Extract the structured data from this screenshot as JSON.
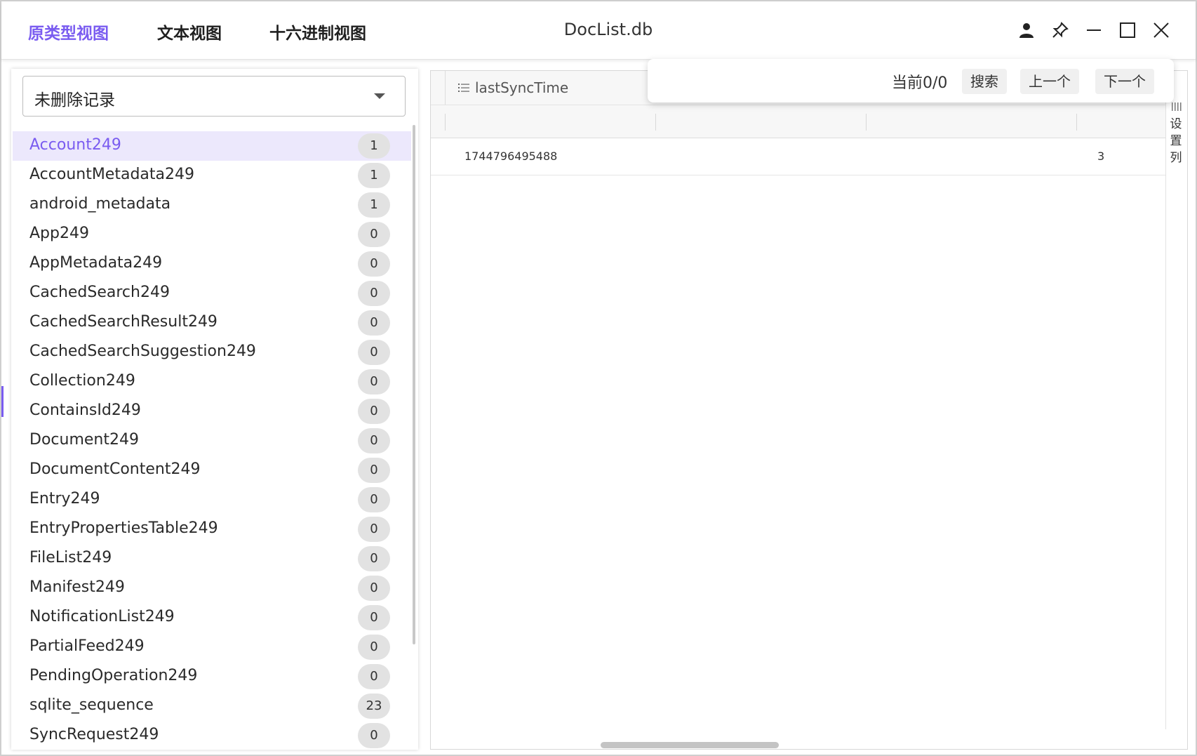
{
  "titlebar": {
    "tabs": [
      {
        "label": "原类型视图",
        "active": true
      },
      {
        "label": "文本视图",
        "active": false
      },
      {
        "label": "十六进制视图",
        "active": false
      }
    ],
    "title": "DocList.db",
    "icons": [
      "user-icon",
      "pin-icon",
      "minimize-icon",
      "maximize-icon",
      "close-icon"
    ]
  },
  "sidebar": {
    "filter": {
      "selected": "未删除记录"
    },
    "tables": [
      {
        "name": "Account249",
        "count": "1",
        "selected": true
      },
      {
        "name": "AccountMetadata249",
        "count": "1"
      },
      {
        "name": "android_metadata",
        "count": "1"
      },
      {
        "name": "App249",
        "count": "0"
      },
      {
        "name": "AppMetadata249",
        "count": "0"
      },
      {
        "name": "CachedSearch249",
        "count": "0"
      },
      {
        "name": "CachedSearchResult249",
        "count": "0"
      },
      {
        "name": "CachedSearchSuggestion249",
        "count": "0"
      },
      {
        "name": "Collection249",
        "count": "0"
      },
      {
        "name": "ContainsId249",
        "count": "0"
      },
      {
        "name": "Document249",
        "count": "0"
      },
      {
        "name": "DocumentContent249",
        "count": "0"
      },
      {
        "name": "Entry249",
        "count": "0"
      },
      {
        "name": "EntryPropertiesTable249",
        "count": "0"
      },
      {
        "name": "FileList249",
        "count": "0"
      },
      {
        "name": "Manifest249",
        "count": "0"
      },
      {
        "name": "NotificationList249",
        "count": "0"
      },
      {
        "name": "PartialFeed249",
        "count": "0"
      },
      {
        "name": "PendingOperation249",
        "count": "0"
      },
      {
        "name": "sqlite_sequence",
        "count": "23"
      },
      {
        "name": "SyncRequest249",
        "count": "0"
      }
    ]
  },
  "grid": {
    "column_header": "lastSyncTime",
    "row": {
      "lastSyncTime": "1744796495488",
      "last_col": "3"
    },
    "settings_label": "设置列"
  },
  "search": {
    "status": "当前0/0",
    "search_button": "搜索",
    "prev_button": "上一个",
    "next_button": "下一个"
  },
  "colors": {
    "accent": "#7a5cf0",
    "badge_bg": "#e2e2e2"
  }
}
